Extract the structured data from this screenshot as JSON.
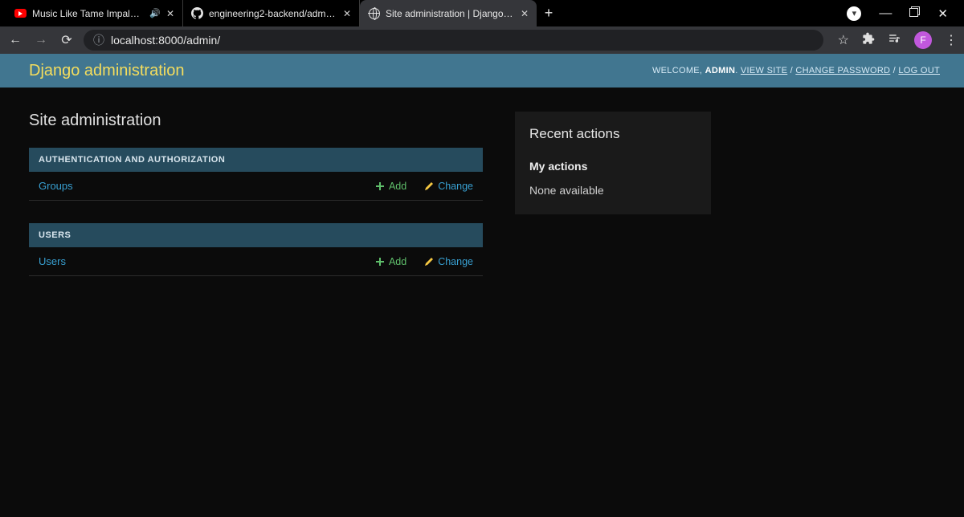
{
  "browser": {
    "tabs": [
      {
        "title": "Music Like Tame Impala | Vol",
        "favicon": "youtube",
        "audio": true
      },
      {
        "title": "engineering2-backend/admin.py",
        "favicon": "github",
        "audio": false
      },
      {
        "title": "Site administration | Django site",
        "favicon": "globe",
        "audio": false
      }
    ],
    "url": "localhost:8000/admin/",
    "avatar_letter": "F"
  },
  "header": {
    "site_title": "Django administration",
    "welcome_label": "WELCOME,",
    "username": "ADMIN",
    "view_site_label": "VIEW SITE",
    "change_password_label": "CHANGE PASSWORD",
    "logout_label": "LOG OUT"
  },
  "page_title": "Site administration",
  "apps": [
    {
      "caption": "AUTHENTICATION AND AUTHORIZATION",
      "models": [
        {
          "name": "Groups",
          "add_label": "Add",
          "change_label": "Change"
        }
      ]
    },
    {
      "caption": "USERS",
      "models": [
        {
          "name": "Users",
          "add_label": "Add",
          "change_label": "Change"
        }
      ]
    }
  ],
  "sidebar": {
    "heading": "Recent actions",
    "subheading": "My actions",
    "empty_text": "None available"
  }
}
